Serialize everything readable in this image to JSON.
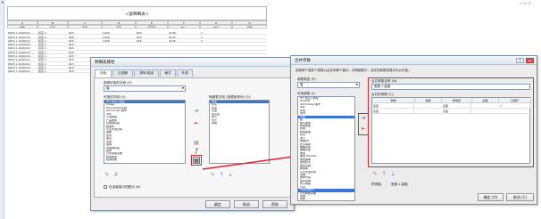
{
  "app": {
    "close_glyph": "✕",
    "top_right_glyphs": "▭ ⊡ ✕"
  },
  "schedule": {
    "title": "<窗明细表>",
    "column_letters": [
      "A",
      "B",
      "C",
      "D",
      "E",
      "F",
      "G",
      "H"
    ],
    "column_headers": [
      "类型",
      "标高",
      "宽度",
      "高度",
      "底高度",
      "防火",
      "合计",
      "说明"
    ],
    "rows": [
      [
        "0915 x 1220mm",
        "标高 1",
        "915",
        "1220",
        "915",
        "2135",
        "1",
        ""
      ],
      [
        "0915 x 1220mm",
        "标高 1",
        "915",
        "1220",
        "915",
        "2135",
        "1",
        ""
      ],
      [
        "0915 x 1220mm",
        "标高 1",
        "915",
        "1220",
        "915",
        "2135",
        "1",
        ""
      ],
      [
        "0915 x 1220mm",
        "标高 1",
        "915",
        "",
        "",
        "",
        "",
        ""
      ],
      [
        "0915 x 1220mm",
        "标高 1",
        "915",
        "",
        "",
        "",
        "",
        ""
      ],
      [
        "0915 x 1220mm",
        "标高 1",
        "915",
        "",
        "",
        "",
        "",
        ""
      ],
      [
        "0915 x 1220mm",
        "标高 1",
        "915",
        "",
        "",
        "",
        "",
        ""
      ],
      [
        "0915 x 1220mm",
        "标高 1",
        "915",
        "",
        "",
        "",
        "",
        ""
      ],
      [
        "0915 x 1220mm",
        "标高 1",
        "915",
        "",
        "",
        "",
        "",
        ""
      ],
      [
        "0915 x 1220mm",
        "标高 1",
        "915",
        "",
        "",
        "",
        "",
        ""
      ],
      [
        "0915 x 1220mm",
        "标高 1",
        "915",
        "",
        "",
        "",
        "",
        ""
      ]
    ]
  },
  "props_dialog": {
    "title": "明细表属性",
    "tabs": [
      "字段",
      "过滤器",
      "排序/成组",
      "格式",
      "外观"
    ],
    "select_label": "选择可用的字段 (F):",
    "select_value": "窗",
    "available_label": "可用的字段 (V):",
    "available_fields": [
      "IFC 预定义类型",
      "Image",
      "OmniClass 标题",
      "OmniClass 编号",
      "URL",
      "不透明度",
      "产品类别",
      "创建的阶段",
      "制造商",
      "可见光透过率",
      "图像",
      "型号",
      "备注",
      "注释",
      "说明",
      "拆除的阶段",
      "操作",
      "日光得热系数",
      "构造类型",
      "框架材质"
    ],
    "scheduled_label": "明细表字段 (按顺序排列) (S):",
    "scheduled_fields": [
      "类型",
      "标高",
      "宽度",
      "高度",
      "底高度",
      "防火",
      "合计",
      "说明"
    ],
    "include_links": "包含链接中的图元 (N)",
    "ok": "确定",
    "cancel": "取消",
    "help": "帮助"
  },
  "combine_dialog": {
    "title": "合并参数",
    "description": "选择两个或多个参数以合并到单个值中。在明细表中，合并的参数将显示为以可读。",
    "param_type_label": "参数类型 (P):",
    "param_type_value": "窗",
    "available_label": "可用参数 (I):",
    "available_items": [
      "IFC 预定义类型",
      "IfcGUID",
      "OmniClass 编号",
      "URL",
      "厚度",
      "型号",
      "宽度",
      "族",
      "族与类型",
      "框架类型",
      "标题",
      "构造类型",
      "标记",
      "洞口",
      "热阻(R)",
      "防火等级",
      "粗略宽度",
      "粗略高度",
      "类型",
      "类型 IfcGUID",
      "类型图像",
      "类型标记",
      "类型注释",
      "制造商",
      "可见光透过率",
      "说明",
      "部件代码",
      "部件说明",
      "防火等级",
      "高度",
      "传热系数(U)",
      "日光得热系数",
      "注释",
      "材质"
    ],
    "combined_name_label": "合并参数名称 (N):",
    "combined_name_value": "宽度 x 高度",
    "combined_params_label": "合并的参数 (C):",
    "table_headers": [
      "参数",
      "前缀",
      "样例值",
      "后缀",
      "分隔符"
    ],
    "table_rows": [
      [
        "宽度",
        "",
        "宽度",
        "",
        "x"
      ],
      [
        "高度",
        "",
        "高度",
        "",
        ""
      ]
    ],
    "sample_label": "样例值:",
    "sample_value": "宽度 x 高度",
    "ok": "确定 (O)",
    "cancel": "取消 (C)"
  },
  "colors": {
    "highlight_red": "#e0262c",
    "selection_blue": "#3875d7"
  }
}
